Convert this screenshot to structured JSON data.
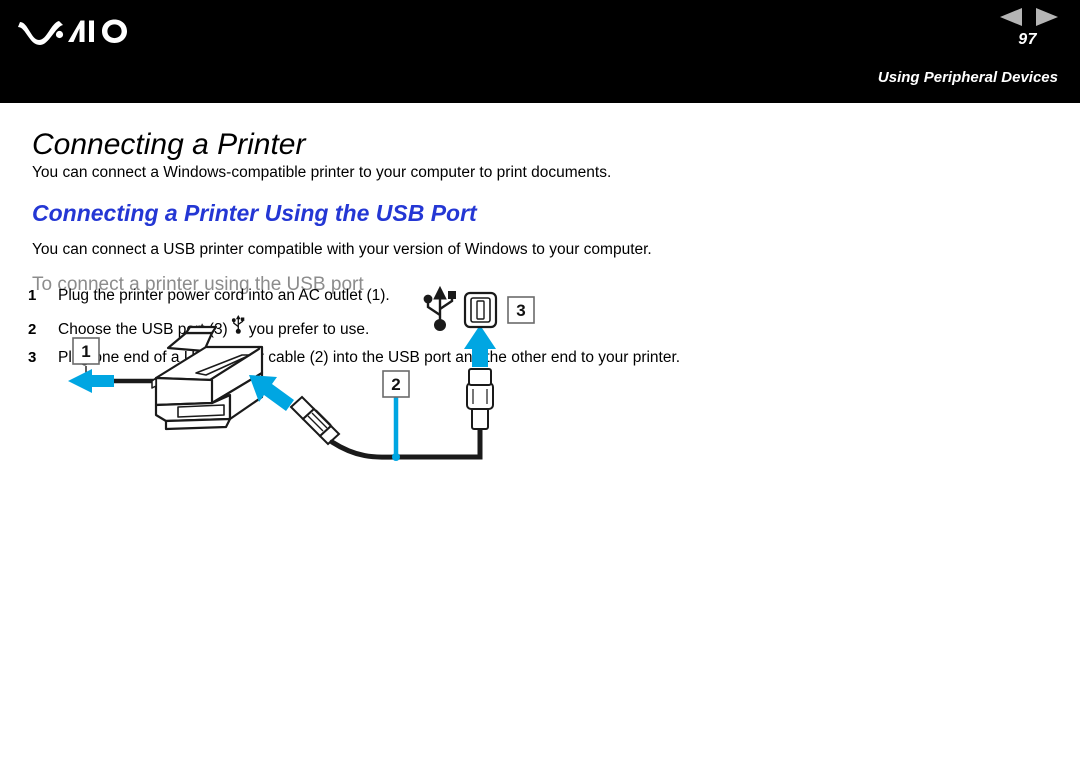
{
  "header": {
    "logo_alt": "VAIO",
    "prev_label": "Previous page",
    "next_label": "Next page",
    "page_number": "97",
    "section_label": "Using Peripheral Devices",
    "background_color": "#000000",
    "arrow_color": "#b5b5b5"
  },
  "main": {
    "page_title": "Connecting a Printer",
    "intro_text": "You can connect a Windows-compatible printer to your computer to print documents.",
    "subsection_title": "Connecting a Printer Using the USB Port",
    "subsection_color": "#2437d4",
    "sub_intro_text": "You can connect a USB printer compatible with your version of Windows to your computer.",
    "procedure_heading": "To connect a printer using the USB port",
    "procedure_heading_color": "#8c8c8c",
    "steps": [
      {
        "number": "1",
        "text_before": "Plug the printer power cord into an AC outlet (1).",
        "has_icon": false,
        "text_after": ""
      },
      {
        "number": "2",
        "text_before": "Choose the USB port (3)",
        "has_icon": true,
        "icon": "usb-trident-icon",
        "text_after": "you prefer to use."
      },
      {
        "number": "3",
        "text_before": "Plug one end of a USB printer cable (2) into the USB port and the other end to your printer.",
        "has_icon": false,
        "text_after": ""
      }
    ]
  },
  "diagram": {
    "accent_color": "#00a6e2",
    "line_color": "#1a1a1a",
    "callouts": [
      {
        "id": "1",
        "label": "1",
        "meaning": "AC outlet / power cord"
      },
      {
        "id": "2",
        "label": "2",
        "meaning": "USB printer cable"
      },
      {
        "id": "3",
        "label": "3",
        "meaning": "USB port"
      }
    ],
    "elements": [
      "printer-illustration",
      "power-cord-line",
      "blue-left-arrow",
      "blue-diagonal-arrow",
      "usb-b-connector",
      "usb-cable",
      "usb-a-connector",
      "blue-up-arrow",
      "usb-port-icon",
      "usb-trident-symbol"
    ]
  }
}
